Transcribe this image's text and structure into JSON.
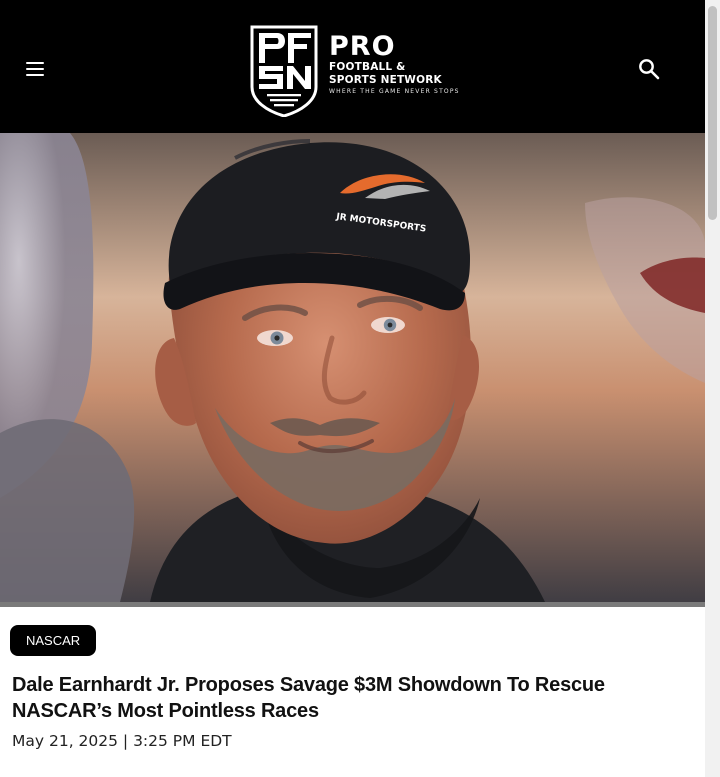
{
  "header": {
    "logo": {
      "mark": "PFSN",
      "pro": "PRO",
      "line1": "FOOTBALL &",
      "line2": "SPORTS NETWORK",
      "tagline": "WHERE THE GAME NEVER STOPS"
    },
    "menu_icon": "hamburger-menu-icon",
    "search_icon": "search-icon"
  },
  "hero": {
    "cap_logo_text": "JR MOTORSPORTS"
  },
  "article": {
    "category": "NASCAR",
    "title": "Dale Earnhardt Jr. Proposes Savage $3M Showdown To Rescue NASCAR’s Most Pointless Races",
    "date": "May 21, 2025 | 3:25 PM EDT"
  },
  "colors": {
    "header_bg": "#000000",
    "pill_bg": "#000000",
    "text": "#111111"
  }
}
